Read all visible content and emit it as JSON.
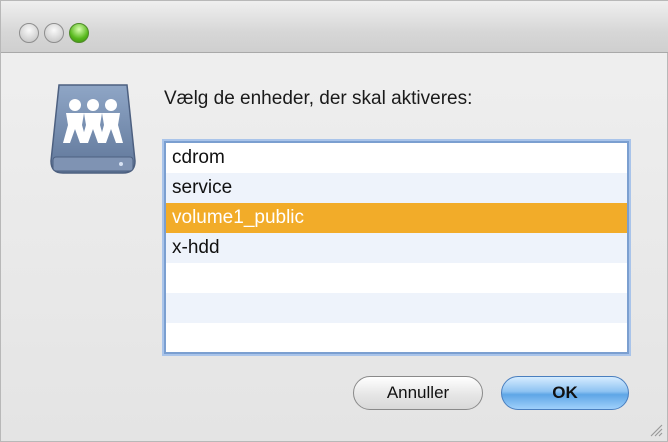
{
  "window": {
    "traffic_lights": [
      "close-icon",
      "minimize-icon",
      "zoom-icon"
    ]
  },
  "icon": {
    "name": "network-drive-icon"
  },
  "dialog": {
    "prompt": "Vælg de enheder, der skal aktiveres:",
    "volumes": [
      {
        "label": "cdrom",
        "selected": false
      },
      {
        "label": "service",
        "selected": false
      },
      {
        "label": "volume1_public",
        "selected": true
      },
      {
        "label": "x-hdd",
        "selected": false
      }
    ],
    "cancel_label": "Annuller",
    "ok_label": "OK"
  },
  "colors": {
    "selection": "#f2ac29",
    "default_button": "#5ea6e6"
  }
}
